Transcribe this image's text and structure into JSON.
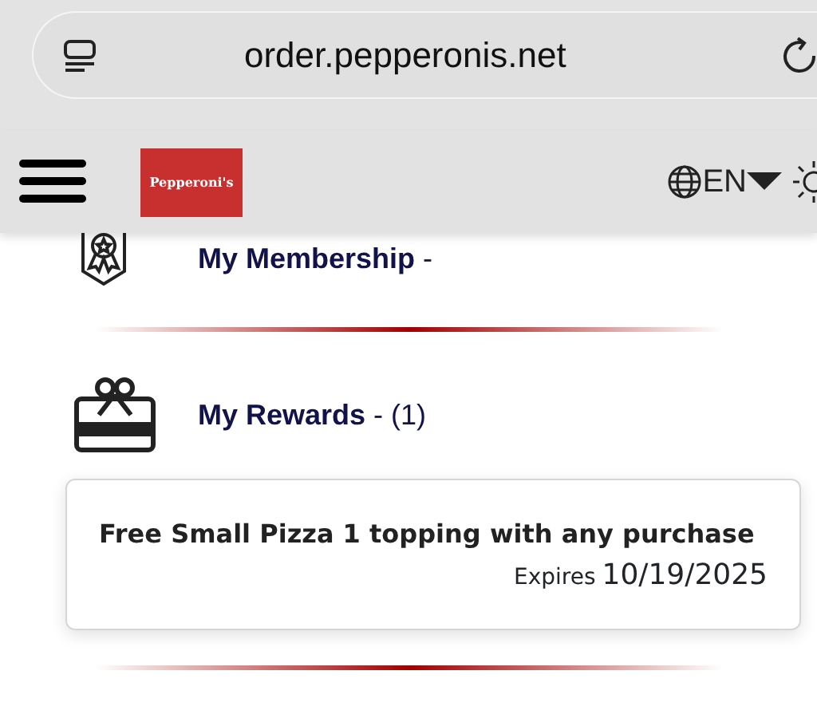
{
  "browser": {
    "url": "order.pepperonis.net"
  },
  "header": {
    "logo": "Pepperoni's",
    "language": "EN"
  },
  "sections": [
    {
      "kind": "membership",
      "title": "My Membership",
      "suffix": " -"
    },
    {
      "kind": "rewards",
      "title": "My Rewards",
      "suffix": " - (1)"
    }
  ],
  "rewards": [
    {
      "title": "Free Small Pizza 1 topping with any purchase",
      "expires_label": "Expires",
      "expires_date": "10/19/2025"
    }
  ]
}
